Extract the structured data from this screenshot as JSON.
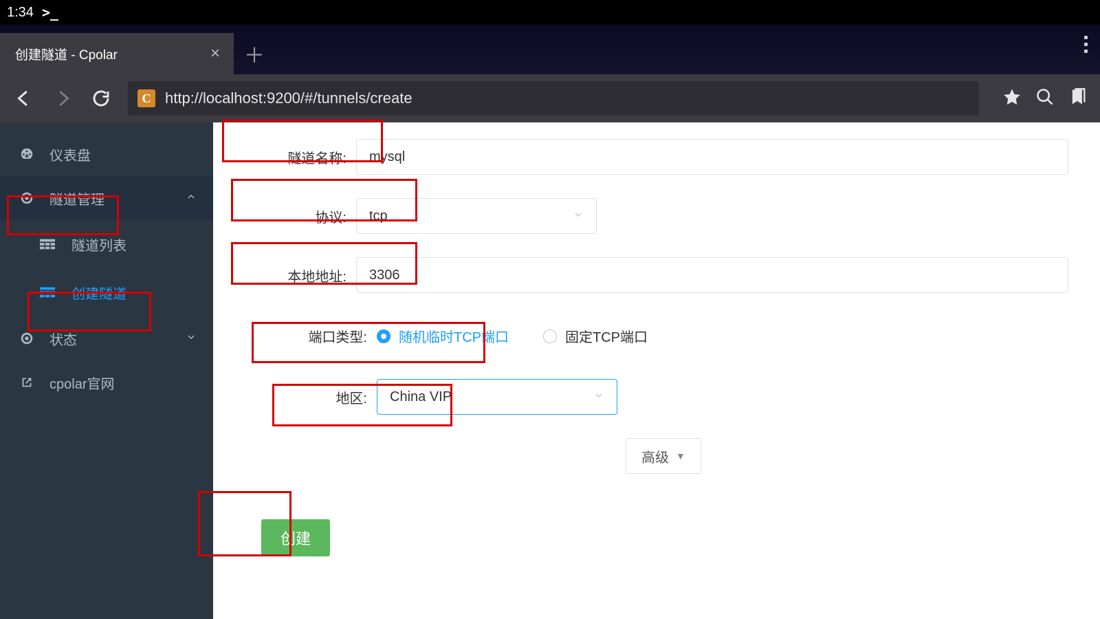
{
  "status": {
    "time": "1:34",
    "term_prompt": ">_"
  },
  "tab": {
    "title": "创建隧道 - Cpolar"
  },
  "address": {
    "url": "http://localhost:9200/#/tunnels/create",
    "site_letter": "C"
  },
  "sidebar": {
    "dashboard": "仪表盘",
    "tunnel_mgmt": "隧道管理",
    "tunnel_list": "隧道列表",
    "create_tunnel": "创建隧道",
    "status": "状态",
    "official": "cpolar官网"
  },
  "form": {
    "name_label": "隧道名称:",
    "name_value": "mysql",
    "proto_label": "协议:",
    "proto_value": "tcp",
    "local_label": "本地地址:",
    "local_value": "3306",
    "port_type_label": "端口类型:",
    "port_type_random": "随机临时TCP端口",
    "port_type_fixed": "固定TCP端口",
    "region_label": "地区:",
    "region_value": "China VIP",
    "advanced": "高级",
    "create": "创建"
  }
}
